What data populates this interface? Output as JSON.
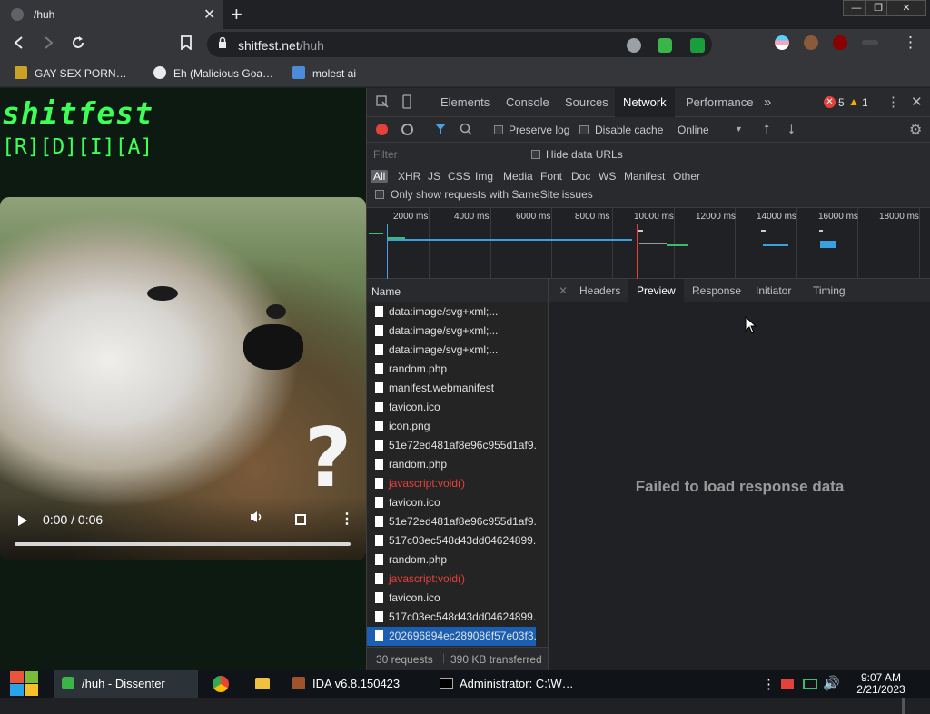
{
  "browser": {
    "tab": {
      "title": "/huh",
      "close": "✕",
      "new": "+"
    },
    "window": {
      "minimize": "—",
      "maximize": "❐",
      "close": "✕"
    },
    "address": {
      "host": "shitfest.net",
      "path": "/huh"
    },
    "bookmarks": [
      {
        "label": "GAY SEX PORN…",
        "color": "#c9a227"
      },
      {
        "label": "Eh (Malicious Goa…",
        "color": "#e8eaed"
      },
      {
        "label": "molest ai",
        "color": "#4a8cd9"
      }
    ],
    "menu": "⋮"
  },
  "page": {
    "title": "shitfest",
    "subtitle": "[R][D][I][A]",
    "video": {
      "time": "0:00 / 0:06",
      "progress": 0,
      "overlay_char": "?"
    }
  },
  "devtools": {
    "tabs": [
      "Elements",
      "Console",
      "Sources",
      "Network",
      "Performance"
    ],
    "active_tab": "Network",
    "more_tabs": "»",
    "errors": "5",
    "warnings": "1",
    "toolbar": {
      "preserve_log": "Preserve log",
      "disable_cache": "Disable cache",
      "throttle": "Online"
    },
    "filter": {
      "placeholder": "Filter",
      "hide_data_urls": "Hide data URLs",
      "types": [
        "All",
        "XHR",
        "JS",
        "CSS",
        "Img",
        "Media",
        "Font",
        "Doc",
        "WS",
        "Manifest",
        "Other"
      ],
      "samesite": "Only show requests with SameSite issues"
    },
    "overview_ticks": [
      "2000 ms",
      "4000 ms",
      "6000 ms",
      "8000 ms",
      "10000 ms",
      "12000 ms",
      "14000 ms",
      "16000 ms",
      "18000 ms"
    ],
    "name_header": "Name",
    "requests": [
      {
        "name": "data:image/svg+xml;...",
        "error": false
      },
      {
        "name": "data:image/svg+xml;...",
        "error": false
      },
      {
        "name": "data:image/svg+xml;...",
        "error": false
      },
      {
        "name": "random.php",
        "error": false
      },
      {
        "name": "manifest.webmanifest",
        "error": false
      },
      {
        "name": "favicon.ico",
        "error": false
      },
      {
        "name": "icon.png",
        "error": false
      },
      {
        "name": "51e72ed481af8e96c955d1af9...",
        "error": false
      },
      {
        "name": "random.php",
        "error": false
      },
      {
        "name": "javascript:void()",
        "error": true
      },
      {
        "name": "favicon.ico",
        "error": false
      },
      {
        "name": "51e72ed481af8e96c955d1af9...",
        "error": false
      },
      {
        "name": "517c03ec548d43dd04624899...",
        "error": false
      },
      {
        "name": "random.php",
        "error": false
      },
      {
        "name": "javascript:void()",
        "error": true
      },
      {
        "name": "favicon.ico",
        "error": false
      },
      {
        "name": "517c03ec548d43dd04624899...",
        "error": false
      },
      {
        "name": "202696894ec289086f57e03f3...",
        "error": false,
        "selected": true
      }
    ],
    "status": {
      "requests": "30 requests",
      "transferred": "390 KB transferred"
    },
    "detail_close": "✕",
    "detail_tabs": [
      "Headers",
      "Preview",
      "Response",
      "Initiator",
      "Timing"
    ],
    "detail_active": "Preview",
    "detail_message": "Failed to load response data"
  },
  "taskbar": {
    "items": [
      {
        "label": "/huh - Dissenter",
        "active": true
      },
      {
        "label": "IDA v6.8.150423",
        "active": false
      },
      {
        "label": "Administrator: C:\\W…",
        "active": false
      }
    ],
    "time": "9:07 AM",
    "date": "2/21/2023"
  },
  "colors": {
    "accent_green": "#3dff55",
    "devtools_bg": "#242424",
    "selected_row": "#1a5fb4",
    "error_text": "#e5413b"
  }
}
